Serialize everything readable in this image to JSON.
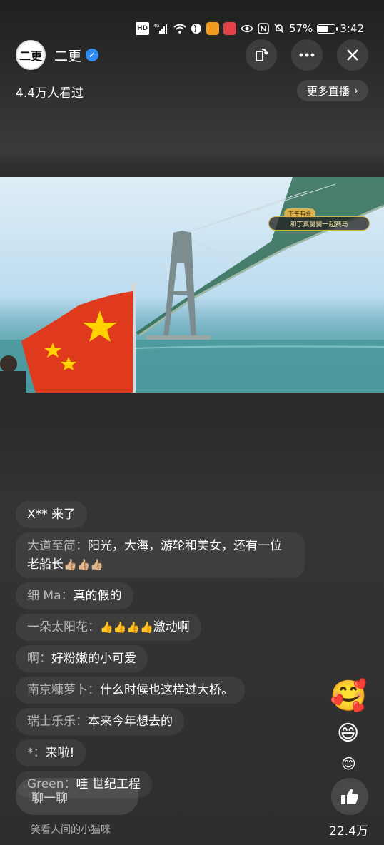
{
  "status_bar": {
    "hd_label": "HD",
    "network": "4G",
    "battery_percent": "57%",
    "battery_level": 0.57,
    "time": "3:42"
  },
  "header": {
    "avatar_text": "二更",
    "anchor_name": "二更",
    "verified_icon": "verified-check-icon"
  },
  "viewers": {
    "count_text": "4.4万人看过",
    "more_live_label": "更多直播"
  },
  "video": {
    "badge_text": "下午有会",
    "caption_text": "和丁真舅舅一起赛马",
    "colors": {
      "sky": "#dfeef7",
      "sea": "#3f8f92",
      "flag": "#e03a1e",
      "star": "#ffd200"
    }
  },
  "comments": [
    {
      "type": "join",
      "user": "X**",
      "text": "来了"
    },
    {
      "type": "comment",
      "user": "大道至简",
      "text": "阳光，大海，游轮和美女，还有一位老船长",
      "emoji": "👍🏼👍🏼👍🏼"
    },
    {
      "type": "comment",
      "user": "细 Ma",
      "text": "真的假的",
      "emoji": ""
    },
    {
      "type": "comment",
      "user": "一朵太阳花",
      "text": "激动啊",
      "emoji": "👍👍👍👍"
    },
    {
      "type": "comment",
      "user": "啊",
      "text": "好粉嫩的小可爱",
      "emoji": ""
    },
    {
      "type": "comment",
      "user": "南京糠萝卜",
      "text": "什么时候也这样过大桥。",
      "emoji": ""
    },
    {
      "type": "comment",
      "user": "瑞士乐乐",
      "text": "本来今年想去的",
      "emoji": ""
    },
    {
      "type": "comment",
      "user": "*",
      "text": "来啦!",
      "emoji": ""
    },
    {
      "type": "comment",
      "user": "Green",
      "text": "哇 世纪工程",
      "emoji": ""
    }
  ],
  "bottom": {
    "chat_placeholder": "聊一聊",
    "current_user": "笑看人间的小猫咪",
    "like_count": "22.4万"
  },
  "reactions": [
    "🥰",
    "😄",
    "😊"
  ]
}
